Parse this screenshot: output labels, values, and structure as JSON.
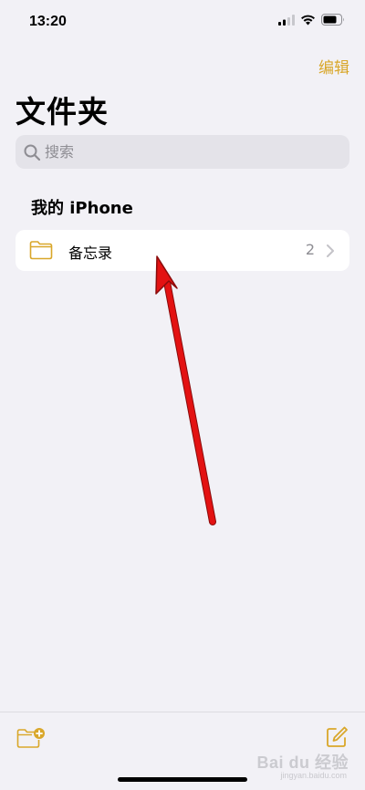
{
  "status_bar": {
    "time": "13:20",
    "icons": [
      "signal-icon",
      "wifi-icon",
      "battery-icon"
    ]
  },
  "nav": {
    "edit_label": "编辑"
  },
  "page": {
    "title": "文件夹"
  },
  "search": {
    "placeholder": "搜索"
  },
  "sections": [
    {
      "header": "我的 iPhone",
      "folders": [
        {
          "name": "备忘录",
          "count": "2",
          "icon": "folder-icon"
        }
      ]
    }
  ],
  "toolbar": {
    "left_icon": "new-folder-icon",
    "right_icon": "compose-icon"
  },
  "watermark": {
    "text": "Bai du 经验",
    "sub": "jingyan.baidu.com"
  },
  "colors": {
    "accent": "#d9a72a",
    "background": "#f2f1f6",
    "annotation_arrow": "#e31212"
  }
}
